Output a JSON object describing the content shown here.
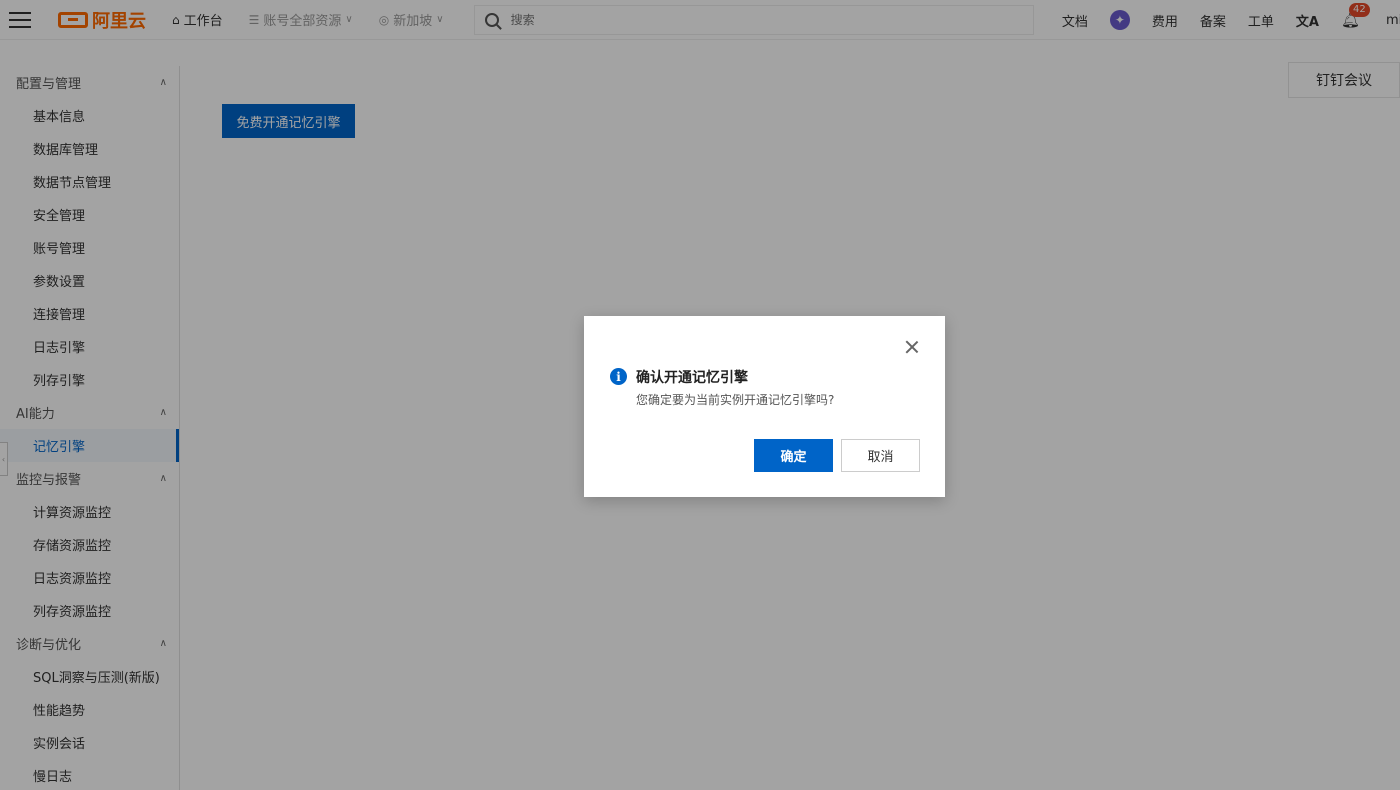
{
  "header": {
    "logo_text": "阿里云",
    "workbench": "工作台",
    "account_resource": "账号全部资源",
    "region": "新加坡",
    "search_placeholder": "搜索",
    "docs": "文档",
    "fees": "费用",
    "filing": "备案",
    "ticket": "工单",
    "lang": "文A",
    "bell_badge": "42",
    "user": "mi"
  },
  "sidebar": {
    "groups": [
      {
        "label": "配置与管理",
        "items": [
          "基本信息",
          "数据库管理",
          "数据节点管理",
          "安全管理",
          "账号管理",
          "参数设置",
          "连接管理",
          "日志引擎",
          "列存引擎"
        ]
      },
      {
        "label": "AI能力",
        "items": [
          "记忆引擎"
        ]
      },
      {
        "label": "监控与报警",
        "items": [
          "计算资源监控",
          "存储资源监控",
          "日志资源监控",
          "列存资源监控"
        ]
      },
      {
        "label": "诊断与优化",
        "items": [
          "SQL洞察与压测(新版)",
          "性能趋势",
          "实例会话",
          "慢日志"
        ]
      }
    ],
    "active_item": "记忆引擎"
  },
  "main": {
    "enable_button": "免费开通记忆引擎",
    "dingtalk": "钉钉会议"
  },
  "dialog": {
    "title": "确认开通记忆引擎",
    "message": "您确定要为当前实例开通记忆引擎吗?",
    "ok": "确定",
    "cancel": "取消"
  }
}
